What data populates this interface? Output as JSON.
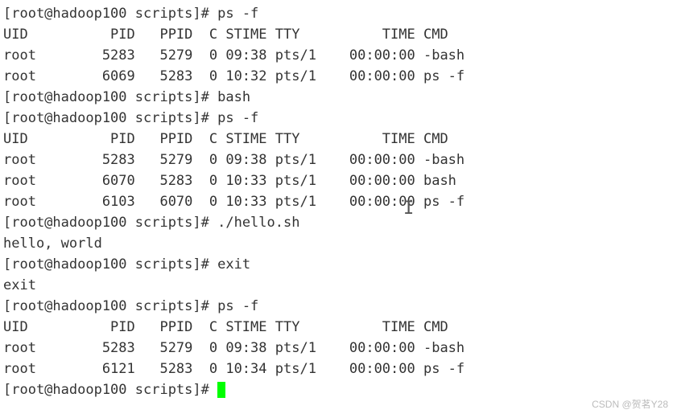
{
  "prompt": "[root@hadoop100 scripts]# ",
  "commands": {
    "psf1": "ps -f",
    "bash": "bash",
    "psf2": "ps -f",
    "hello": "./hello.sh",
    "exit": "exit",
    "psf3": "ps -f"
  },
  "header": "UID          PID   PPID  C STIME TTY          TIME CMD",
  "block1": {
    "r1": "root        5283   5279  0 09:38 pts/1    00:00:00 -bash",
    "r2": "root        6069   5283  0 10:32 pts/1    00:00:00 ps -f"
  },
  "block2": {
    "r1": "root        5283   5279  0 09:38 pts/1    00:00:00 -bash",
    "r2": "root        6070   5283  0 10:33 pts/1    00:00:00 bash",
    "r3": "root        6103   6070  0 10:33 pts/1    00:00:00 ps -f"
  },
  "block3": {
    "r1": "root        5283   5279  0 09:38 pts/1    00:00:00 -bash",
    "r2": "root        6121   5283  0 10:34 pts/1    00:00:00 ps -f"
  },
  "output": {
    "hello": "hello, world",
    "exit": "exit"
  },
  "watermark": "CSDN @贺茗Y28"
}
